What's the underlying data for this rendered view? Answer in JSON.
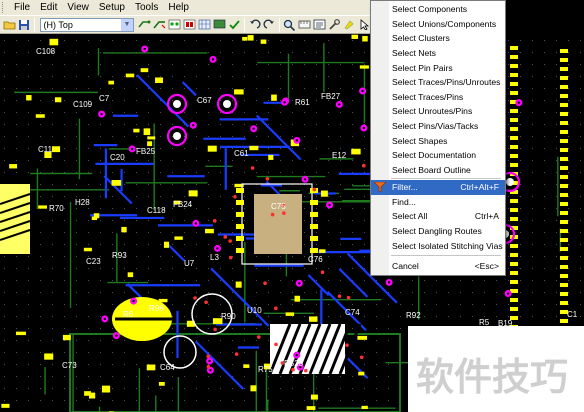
{
  "menubar": {
    "items": [
      "File",
      "Edit",
      "View",
      "Setup",
      "Tools",
      "Help"
    ]
  },
  "toolbar": {
    "layer_value": "(H) Top"
  },
  "canvas": {
    "ref_labels": [
      "C108",
      "C109",
      "C20",
      "C118",
      "U7",
      "R90",
      "R75",
      "R61",
      "E12",
      "R70",
      "C23",
      "R6",
      "C64",
      "C67",
      "C61",
      "C75",
      "C76",
      "C74",
      "C73",
      "C7",
      "FB25",
      "FB24",
      "L3",
      "U10",
      "FB23",
      "FB27",
      "C11",
      "H28",
      "R93",
      "R96",
      "CE15",
      "R99",
      "R92",
      "D17",
      "R18",
      "U19",
      "B19",
      "C17",
      "R1",
      "C1",
      "R60",
      "R9",
      "C2",
      "R5"
    ]
  },
  "context_menu": {
    "items": [
      {
        "label": "Select Components",
        "shortcut": ""
      },
      {
        "label": "Select Unions/Components",
        "shortcut": ""
      },
      {
        "label": "Select Clusters",
        "shortcut": ""
      },
      {
        "label": "Select Nets",
        "shortcut": ""
      },
      {
        "label": "Select Pin Pairs",
        "shortcut": ""
      },
      {
        "label": "Select Traces/Pins/Unroutes",
        "shortcut": ""
      },
      {
        "label": "Select Traces/Pins",
        "shortcut": ""
      },
      {
        "label": "Select Unroutes/Pins",
        "shortcut": ""
      },
      {
        "label": "Select Pins/Vias/Tacks",
        "shortcut": ""
      },
      {
        "label": "Select Shapes",
        "shortcut": ""
      },
      {
        "label": "Select Documentation",
        "shortcut": ""
      },
      {
        "label": "Select Board Outline",
        "shortcut": ""
      },
      {
        "label": "Filter...",
        "shortcut": "Ctrl+Alt+F"
      },
      {
        "label": "Find...",
        "shortcut": ""
      },
      {
        "label": "Select All",
        "shortcut": "Ctrl+A"
      },
      {
        "label": "Select Dangling Routes",
        "shortcut": ""
      },
      {
        "label": "Select Isolated Stitching Vias",
        "shortcut": ""
      },
      {
        "label": "Cancel",
        "shortcut": "<Esc>"
      }
    ],
    "highlighted": "Filter..."
  },
  "watermark": {
    "text": "软件技巧"
  },
  "colors": {
    "menu_bg": "#ece9d8",
    "highlight": "#316ac5",
    "trace_green": "#1f7a1f",
    "trace_blue": "#1a3cff",
    "pad_yellow": "#ffff00",
    "via_magenta": "#ff00ff"
  }
}
